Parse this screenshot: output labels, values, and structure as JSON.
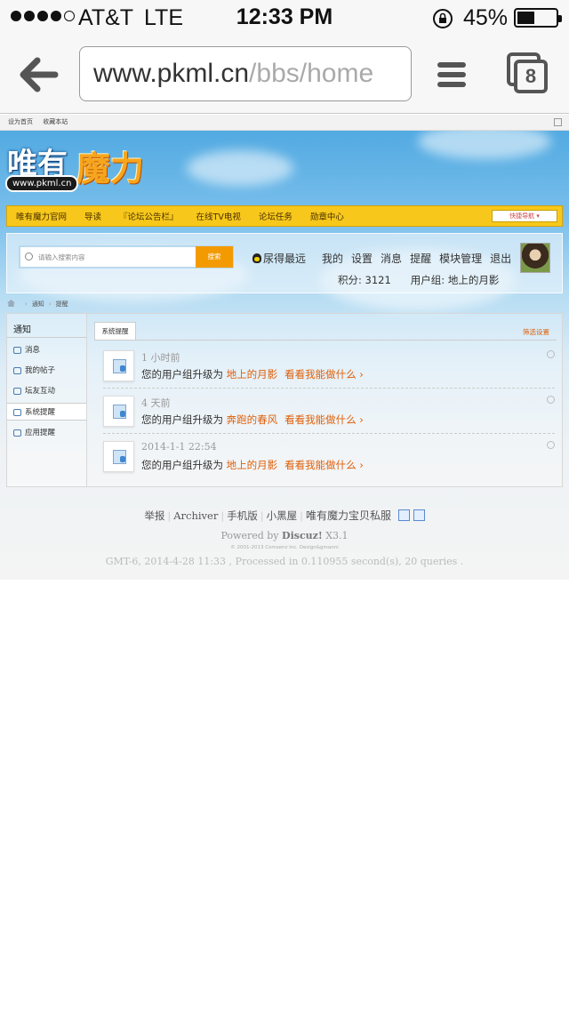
{
  "status_bar": {
    "carrier": "AT&T",
    "network": "LTE",
    "time": "12:33 PM",
    "battery_percent": "45%",
    "battery_level": 0.45,
    "signal_bars": 4
  },
  "browser": {
    "url_host": "www.pkml.cn",
    "url_path": "/bbs/home",
    "tab_count": "8"
  },
  "topbar": {
    "links": [
      "设为首页",
      "收藏本站"
    ]
  },
  "logo": {
    "text_left": "唯有",
    "text_right": "魔力",
    "url": "www.pkml.cn"
  },
  "nav": {
    "items": [
      "唯有魔力官网",
      "导读",
      "『论坛公告栏』",
      "在线TV电视",
      "论坛任务",
      "勋章中心"
    ],
    "quick_nav": "快捷导航"
  },
  "search": {
    "placeholder": "请输入搜索内容",
    "button": "搜索"
  },
  "user": {
    "name": "尿得最远",
    "menu": [
      "我的",
      "设置",
      "消息",
      "提醒",
      "模块管理",
      "退出"
    ],
    "points": "积分: 3121",
    "group": "用户组: 地上的月影"
  },
  "breadcrumb": [
    "通知",
    "提醒"
  ],
  "sidebar": {
    "title": "通知",
    "items": [
      "消息",
      "我的帖子",
      "坛友互动",
      "系统提醒",
      "应用提醒"
    ],
    "active_index": 3
  },
  "main": {
    "tab": "系统提醒",
    "filter": "筛选设置",
    "notifications": [
      {
        "time": "1 小时前",
        "text": "您的用户组升级为",
        "group": "地上的月影",
        "link": "看看我能做什么 ›"
      },
      {
        "time": "4 天前",
        "text": "您的用户组升级为",
        "group": "奔跑的春风",
        "link": "看看我能做什么 ›"
      },
      {
        "time": "2014-1-1 22:54",
        "text": "您的用户组升级为",
        "group": "地上的月影",
        "link": "看看我能做什么 ›"
      }
    ]
  },
  "footer": {
    "links": [
      "举报",
      "Archiver",
      "手机版",
      "小黑屋"
    ],
    "site_name": "唯有魔力宝贝私服",
    "powered_prefix": "Powered by",
    "powered_brand": "Discuz!",
    "powered_version": "X3.1",
    "copyright": "© 2001-2013 Comsenz Inc. Design&gmanni",
    "gmt": "GMT-6, 2014-4-28 11:33 , Processed in 0.110955 second(s), 20 queries ."
  }
}
